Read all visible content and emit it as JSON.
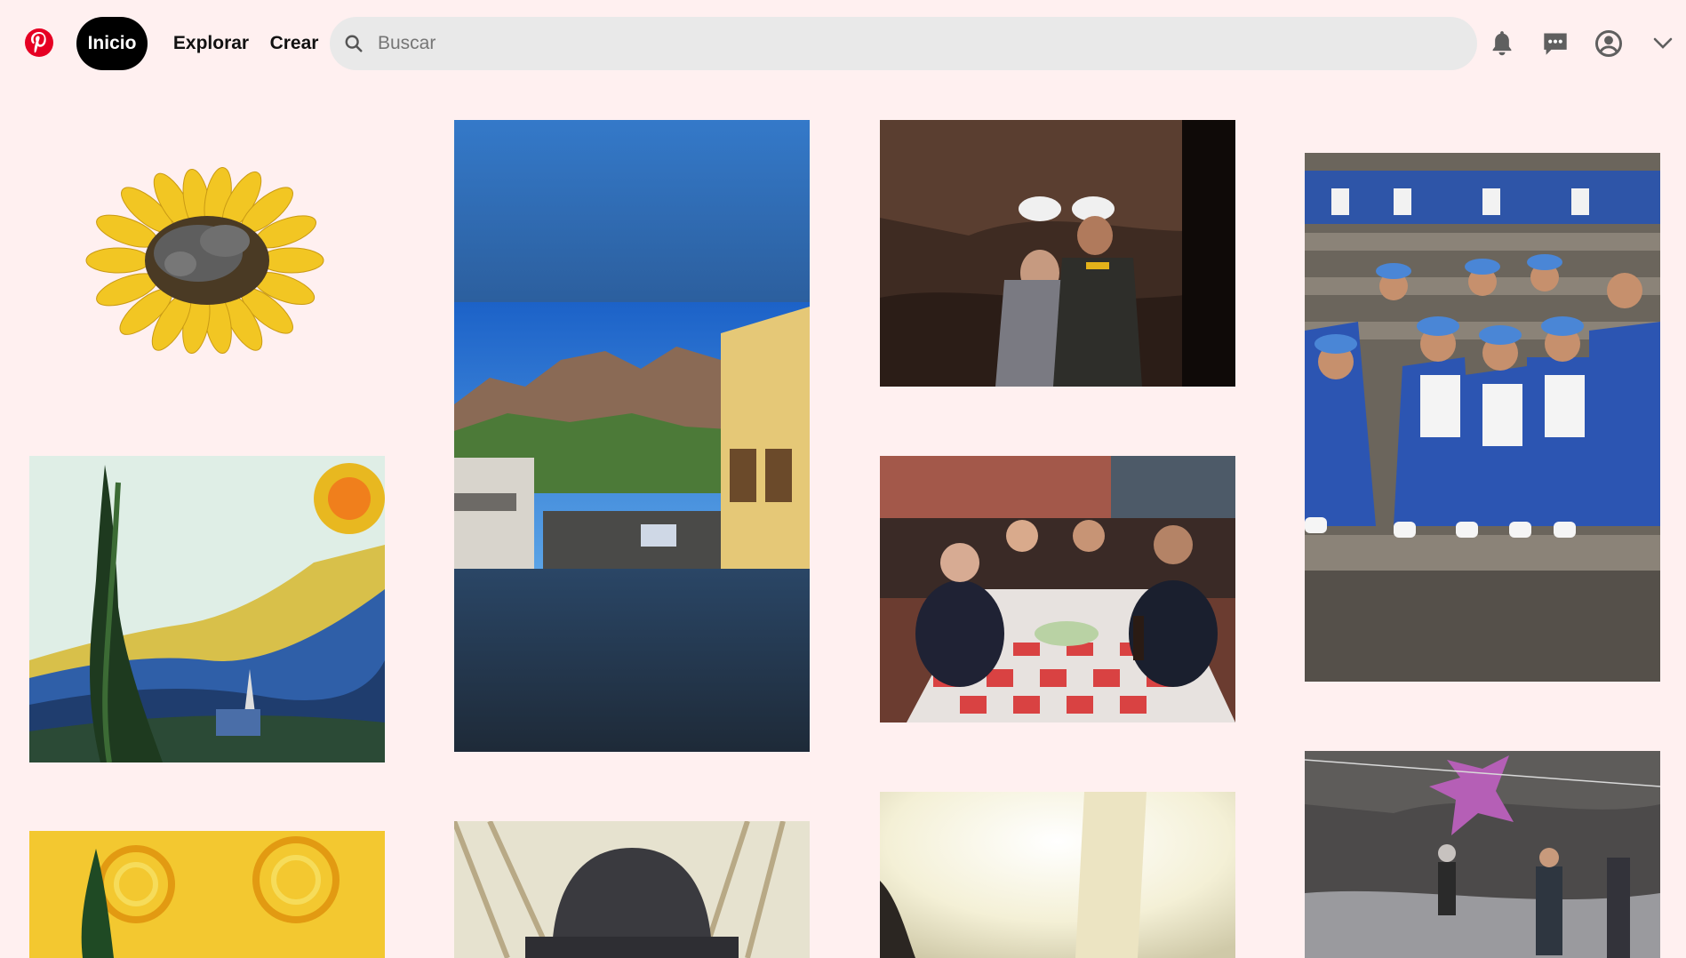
{
  "header": {
    "logo_icon": "pinterest-logo",
    "nav": {
      "home": "Inicio",
      "explore": "Explorar",
      "create": "Crear"
    },
    "search": {
      "placeholder": "Buscar",
      "value": ""
    },
    "icons": [
      "bell-icon",
      "messages-icon",
      "profile-icon",
      "chevron-down-icon"
    ]
  },
  "colors": {
    "brand": "#e60023",
    "background": "#fff0f0",
    "active_nav": "#000000"
  },
  "pins": [
    {
      "name": "pin-sunflower-sculpture",
      "image": "sunflower sculpture with sleeping creature"
    },
    {
      "name": "pin-mountain-town-street",
      "image": "street with mountains and blue sky"
    },
    {
      "name": "pin-mine-helmets",
      "image": "two people wearing white helmets in a mine"
    },
    {
      "name": "pin-students-stairs",
      "image": "group of students in blue uniforms on stone steps"
    },
    {
      "name": "pin-starry-night-cypress",
      "image": "Van Gogh style painting with cypress"
    },
    {
      "name": "pin-restaurant-friends",
      "image": "friends at a restaurant table"
    },
    {
      "name": "pin-starry-swirl",
      "image": "Van Gogh yellow swirl sky painting"
    },
    {
      "name": "pin-person-hat",
      "image": "person wearing a bucket hat"
    },
    {
      "name": "pin-bright-window",
      "image": "overexposed indoor photo"
    },
    {
      "name": "pin-pinata-night",
      "image": "piñata at night"
    }
  ]
}
